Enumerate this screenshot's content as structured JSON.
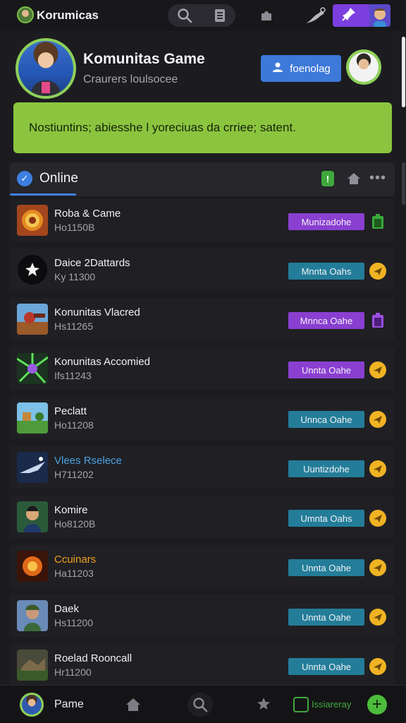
{
  "header": {
    "app_title": "Korumicas",
    "icons": [
      "search-icon",
      "document-icon",
      "puzzle-icon",
      "plant-icon",
      "pin-icon"
    ]
  },
  "profile": {
    "name": "Komunitas Game",
    "subtitle": "Craurers loulsocee",
    "follow_label": "foenolag"
  },
  "banner": {
    "text": "Nostiuntins; abiesshe l yoreciuas da crriee; satent."
  },
  "online": {
    "label": "Online",
    "check": "✓",
    "alert": "!",
    "more": "•••"
  },
  "games": [
    {
      "title": "Roba & Came",
      "code": "Ho1150B",
      "tag": "Munizadohe",
      "tag_color": "purple",
      "icon": "trash-icon",
      "icon_style": "square-green"
    },
    {
      "title": "Daice 2Dattards",
      "code": "Ky 11300",
      "tag": "Mnnta Oahs",
      "tag_color": "teal",
      "icon": "plane-icon",
      "icon_style": "round"
    },
    {
      "title": "Konunitas Vlacred",
      "code": "Hs11265",
      "tag": "Mnnca Oahe",
      "tag_color": "purple",
      "icon": "trash-icon",
      "icon_style": "square-purple"
    },
    {
      "title": "Konunitas Accomied",
      "code": "Ifs11243",
      "tag": "Unnta Oahe",
      "tag_color": "purple",
      "icon": "plane-icon",
      "icon_style": "round"
    },
    {
      "title": "Peclatt",
      "code": "Ho11208",
      "tag": "Unnca Oahe",
      "tag_color": "teal",
      "icon": "plane-icon",
      "icon_style": "round"
    },
    {
      "title": "Vlees Rselece",
      "code": "H711202",
      "tag": "Uuntizdohe",
      "tag_color": "teal",
      "icon": "plane-icon",
      "icon_style": "round"
    },
    {
      "title": "Komire",
      "code": "Ho8120B",
      "tag": "Umnta Oahs",
      "tag_color": "teal",
      "icon": "plane-icon",
      "icon_style": "round"
    },
    {
      "title": "Ccuinars",
      "code": "Ha11203",
      "tag": "Unnta Oahe",
      "tag_color": "teal",
      "icon": "plane-icon",
      "icon_style": "round"
    },
    {
      "title": "Daek",
      "code": "Hs11200",
      "tag": "Unnta Oahe",
      "tag_color": "teal",
      "icon": "plane-icon",
      "icon_style": "round"
    },
    {
      "title": "Roelad Rooncall",
      "code": "Hr11200",
      "tag": "Unnta Oahe",
      "tag_color": "teal",
      "icon": "plane-icon",
      "icon_style": "round"
    }
  ],
  "bottom_nav": {
    "label": "Pame",
    "box_label": "Issiareray",
    "add": "+"
  },
  "colors": {
    "accent_blue": "#3d79d8",
    "banner_green": "#8bc53f",
    "tag_purple": "#8a3fd1",
    "tag_teal": "#237d99",
    "badge_yellow": "#f0b323"
  }
}
